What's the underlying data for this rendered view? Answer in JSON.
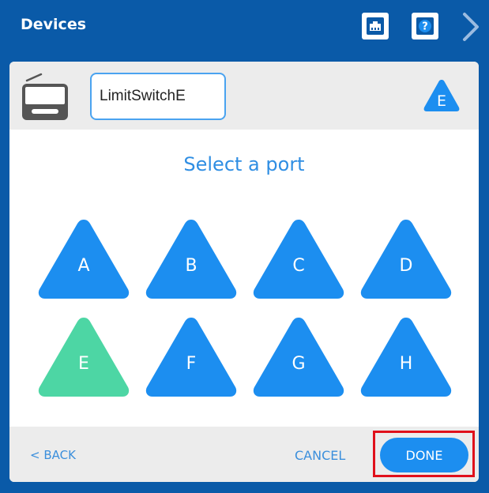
{
  "header": {
    "title": "Devices",
    "port_icon": "ethernet-port-icon",
    "help_icon": "question-icon",
    "help_glyph": "?",
    "next_icon": "chevron-right-icon"
  },
  "device": {
    "icon": "limit-switch-device-icon",
    "name_value": "LimitSwitchE",
    "selected_port": "E"
  },
  "select_title": "Select a port",
  "ports": [
    {
      "label": "A",
      "selected": false
    },
    {
      "label": "B",
      "selected": false
    },
    {
      "label": "C",
      "selected": false
    },
    {
      "label": "D",
      "selected": false
    },
    {
      "label": "E",
      "selected": true
    },
    {
      "label": "F",
      "selected": false
    },
    {
      "label": "G",
      "selected": false
    },
    {
      "label": "H",
      "selected": false
    }
  ],
  "footer": {
    "back_label": "< BACK",
    "cancel_label": "CANCEL",
    "done_label": "DONE"
  },
  "colors": {
    "header_bg": "#0a5aa8",
    "port_default": "#1c8ef0",
    "port_selected": "#4dd6a4",
    "highlight_border": "#e0101b"
  }
}
